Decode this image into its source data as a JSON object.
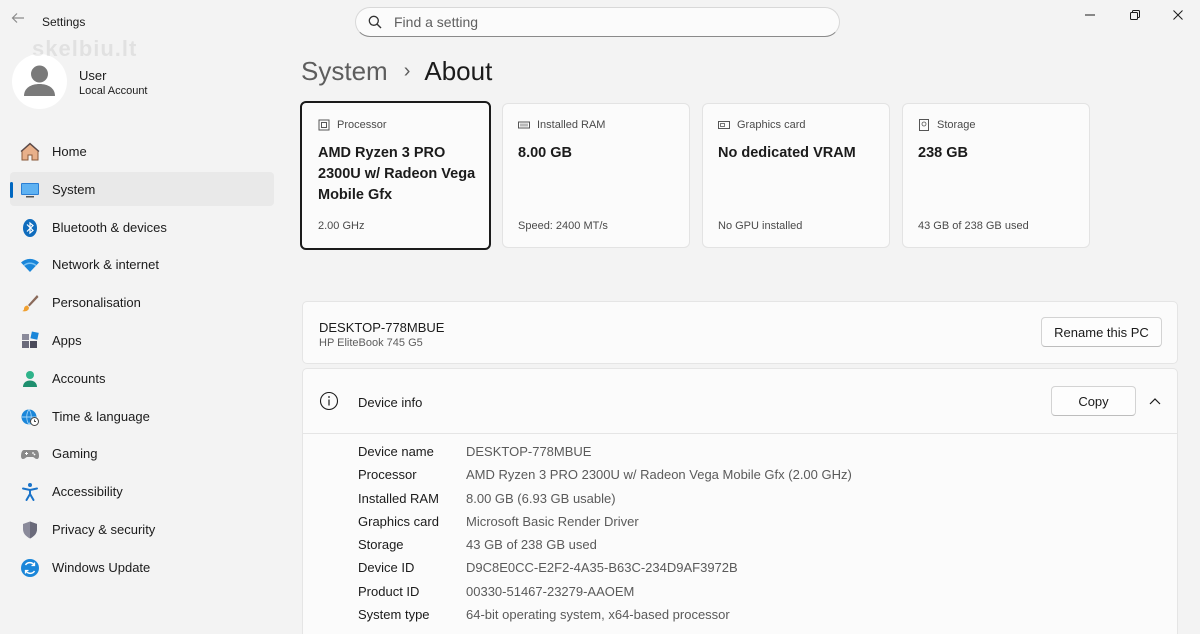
{
  "titlebar": {
    "app_title": "Settings",
    "search_placeholder": "Find a setting"
  },
  "watermark": "skelbiu.lt",
  "user": {
    "name": "User",
    "account_type": "Local Account"
  },
  "sidebar": {
    "items": [
      {
        "label": "Home",
        "icon": "home-icon",
        "active": false
      },
      {
        "label": "System",
        "icon": "system-icon",
        "active": true
      },
      {
        "label": "Bluetooth & devices",
        "icon": "bluetooth-icon",
        "active": false
      },
      {
        "label": "Network & internet",
        "icon": "wifi-icon",
        "active": false
      },
      {
        "label": "Personalisation",
        "icon": "brush-icon",
        "active": false
      },
      {
        "label": "Apps",
        "icon": "apps-icon",
        "active": false
      },
      {
        "label": "Accounts",
        "icon": "person-icon",
        "active": false
      },
      {
        "label": "Time & language",
        "icon": "globe-clock-icon",
        "active": false
      },
      {
        "label": "Gaming",
        "icon": "gamepad-icon",
        "active": false
      },
      {
        "label": "Accessibility",
        "icon": "accessibility-icon",
        "active": false
      },
      {
        "label": "Privacy & security",
        "icon": "shield-icon",
        "active": false
      },
      {
        "label": "Windows Update",
        "icon": "update-icon",
        "active": false
      }
    ]
  },
  "breadcrumb": {
    "parent": "System",
    "separator": "›",
    "current": "About"
  },
  "spec_cards": [
    {
      "title": "Processor",
      "value": "AMD Ryzen 3 PRO 2300U w/ Radeon Vega Mobile Gfx",
      "sub": "2.00 GHz",
      "icon": "processor-icon"
    },
    {
      "title": "Installed RAM",
      "value": "8.00 GB",
      "sub": "Speed: 2400 MT/s",
      "icon": "ram-icon"
    },
    {
      "title": "Graphics card",
      "value": "No dedicated VRAM",
      "sub": "No GPU installed",
      "icon": "graphics-card-icon"
    },
    {
      "title": "Storage",
      "value": "238 GB",
      "sub": "43 GB of 238 GB used",
      "icon": "storage-icon"
    }
  ],
  "pc": {
    "name": "DESKTOP-778MBUE",
    "model": "HP EliteBook 745 G5",
    "rename_label": "Rename this PC"
  },
  "device_info": {
    "title": "Device info",
    "copy_label": "Copy",
    "rows": [
      {
        "label": "Device name",
        "value": "DESKTOP-778MBUE"
      },
      {
        "label": "Processor",
        "value": "AMD Ryzen 3 PRO 2300U w/ Radeon Vega Mobile Gfx (2.00 GHz)"
      },
      {
        "label": "Installed RAM",
        "value": "8.00 GB (6.93 GB usable)"
      },
      {
        "label": "Graphics card",
        "value": "Microsoft Basic Render Driver"
      },
      {
        "label": "Storage",
        "value": "43 GB of 238 GB used"
      },
      {
        "label": "Device ID",
        "value": "D9C8E0CC-E2F2-4A35-B63C-234D9AF3972B"
      },
      {
        "label": "Product ID",
        "value": "00330-51467-23279-AAOEM"
      },
      {
        "label": "System type",
        "value": "64-bit operating system, x64-based processor"
      }
    ]
  },
  "colors": {
    "accent": "#0067c0",
    "background": "#f3f3f3",
    "card": "#fbfbfb"
  }
}
